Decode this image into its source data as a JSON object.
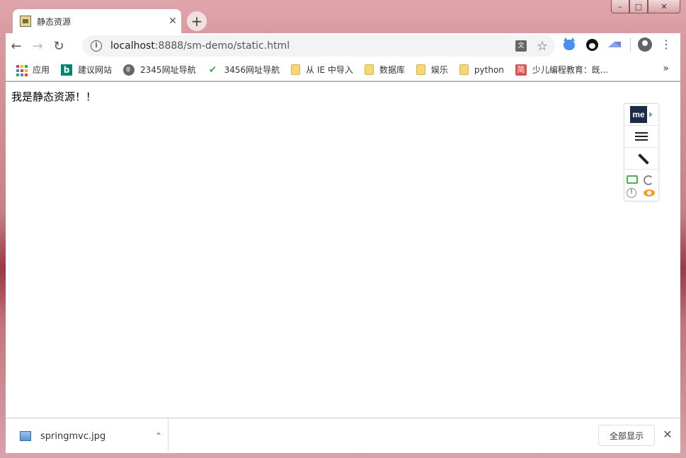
{
  "window": {
    "minimize_glyph": "–",
    "maximize_glyph": "□",
    "close_glyph": "✕"
  },
  "tab": {
    "title": "静态资源",
    "close_glyph": "✕",
    "new_tab_glyph": "+"
  },
  "toolbar": {
    "back_glyph": "←",
    "forward_glyph": "→",
    "reload_glyph": "↻",
    "url_host": "localhost",
    "url_rest": ":8888/sm-demo/static.html",
    "info_glyph": "i",
    "translate_glyph": "文",
    "star_glyph": "☆",
    "menu_glyph": "⋮"
  },
  "bookmarks": {
    "items": [
      {
        "label": "应用",
        "icon": "apps-grid-icon"
      },
      {
        "label": "建议网站",
        "icon": "bing-icon"
      },
      {
        "label": "2345网址导航",
        "icon": "globe-icon"
      },
      {
        "label": "3456网址导航",
        "icon": "hao-icon"
      },
      {
        "label": "从 IE 中导入",
        "icon": "folder-icon"
      },
      {
        "label": "数据库",
        "icon": "folder-icon"
      },
      {
        "label": "娱乐",
        "icon": "folder-icon"
      },
      {
        "label": "python",
        "icon": "folder-icon"
      },
      {
        "label": "少儿编程教育：既...",
        "icon": "jian-icon"
      }
    ],
    "bing_glyph": "b",
    "hao_glyph": "✔",
    "jian_glyph": "简",
    "more_glyph": "»"
  },
  "content": {
    "text": "我是静态资源！！"
  },
  "widget": {
    "logo_text": "me",
    "alert_glyph": "!"
  },
  "downloads": {
    "file_name": "springmvc.jpg",
    "chevron_glyph": "⌃",
    "show_all_label": "全部显示",
    "close_glyph": "✕"
  },
  "colors": {
    "apps_grid": [
      "#ea4335",
      "#fbbc05",
      "#34a853",
      "#4285f4",
      "#ea4335",
      "#fbbc05",
      "#34a853",
      "#4285f4",
      "#ea4335"
    ]
  }
}
